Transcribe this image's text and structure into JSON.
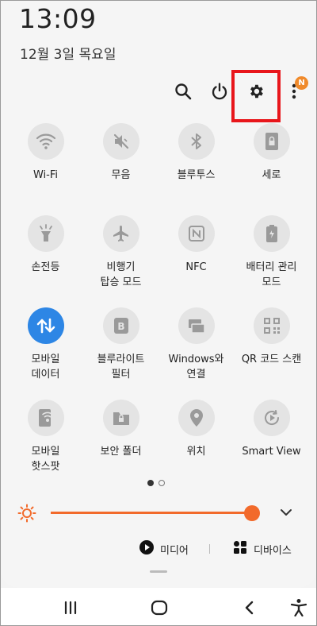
{
  "status": {
    "time": "13:09",
    "date": "12월 3일 목요일"
  },
  "top_actions": {
    "notification_badge": "N"
  },
  "tiles": [
    {
      "label": "Wi-Fi",
      "icon": "wifi-icon"
    },
    {
      "label": "무음",
      "icon": "mute-icon"
    },
    {
      "label": "블루투스",
      "icon": "bluetooth-icon"
    },
    {
      "label": "세로",
      "icon": "portrait-lock-icon"
    },
    {
      "label": "손전등",
      "icon": "flashlight-icon"
    },
    {
      "label": "비행기\n탑승 모드",
      "icon": "airplane-icon"
    },
    {
      "label": "NFC",
      "icon": "nfc-icon"
    },
    {
      "label": "배터리 관리\n모드",
      "icon": "battery-icon"
    },
    {
      "label": "모바일\n데이터",
      "icon": "mobile-data-icon",
      "active": true
    },
    {
      "label": "블루라이트\n필터",
      "icon": "blue-light-icon"
    },
    {
      "label": "Windows와\n연결",
      "icon": "link-windows-icon"
    },
    {
      "label": "QR 코드 스캔",
      "icon": "qr-icon"
    },
    {
      "label": "모바일\n핫스팟",
      "icon": "hotspot-icon"
    },
    {
      "label": "보안 폴더",
      "icon": "secure-folder-icon"
    },
    {
      "label": "위치",
      "icon": "location-icon"
    },
    {
      "label": "Smart View",
      "icon": "smart-view-icon"
    }
  ],
  "pagination": {
    "current": 1,
    "total": 2
  },
  "brightness": {
    "level": 0.97
  },
  "media": {
    "media_label": "미디어",
    "devices_label": "디바이스"
  },
  "colors": {
    "accent": "#f26a2b",
    "active_tile": "#2d86e5",
    "highlight": "#e8161b",
    "badge": "#f08a2b"
  }
}
